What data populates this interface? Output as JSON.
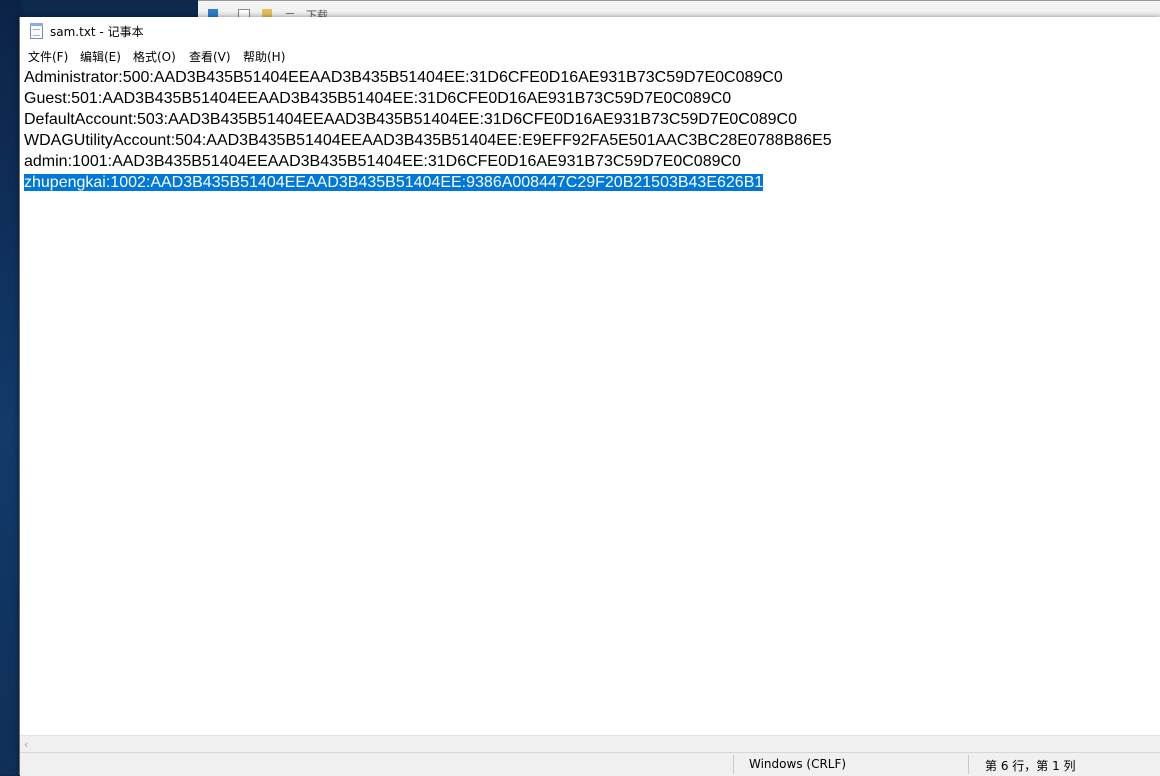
{
  "background_window": {
    "label": "下载"
  },
  "window": {
    "title": "sam.txt - 记事本",
    "icon": "notepad-icon"
  },
  "menu": [
    {
      "label": "文件(F)"
    },
    {
      "label": "编辑(E)"
    },
    {
      "label": "格式(O)"
    },
    {
      "label": "查看(V)"
    },
    {
      "label": "帮助(H)"
    }
  ],
  "document": {
    "lines": [
      "Administrator:500:AAD3B435B51404EEAAD3B435B51404EE:31D6CFE0D16AE931B73C59D7E0C089C0",
      "Guest:501:AAD3B435B51404EEAAD3B435B51404EE:31D6CFE0D16AE931B73C59D7E0C089C0",
      "DefaultAccount:503:AAD3B435B51404EEAAD3B435B51404EE:31D6CFE0D16AE931B73C59D7E0C089C0",
      "WDAGUtilityAccount:504:AAD3B435B51404EEAAD3B435B51404EE:E9EFF92FA5E501AAC3BC28E0788B86E5",
      "admin:1001:AAD3B435B51404EEAAD3B435B51404EE:31D6CFE0D16AE931B73C59D7E0C089C0",
      "zhupengkai:1002:AAD3B435B51404EEAAD3B435B51404EE:9386A008447C29F20B21503B43E626B1"
    ],
    "selected_line_index": 5
  },
  "status": {
    "encoding": "Windows (CRLF)",
    "position": "第 6 行，第 1 列"
  },
  "colors": {
    "selection": "#0078d7",
    "statusbar": "#f0f0f0"
  }
}
